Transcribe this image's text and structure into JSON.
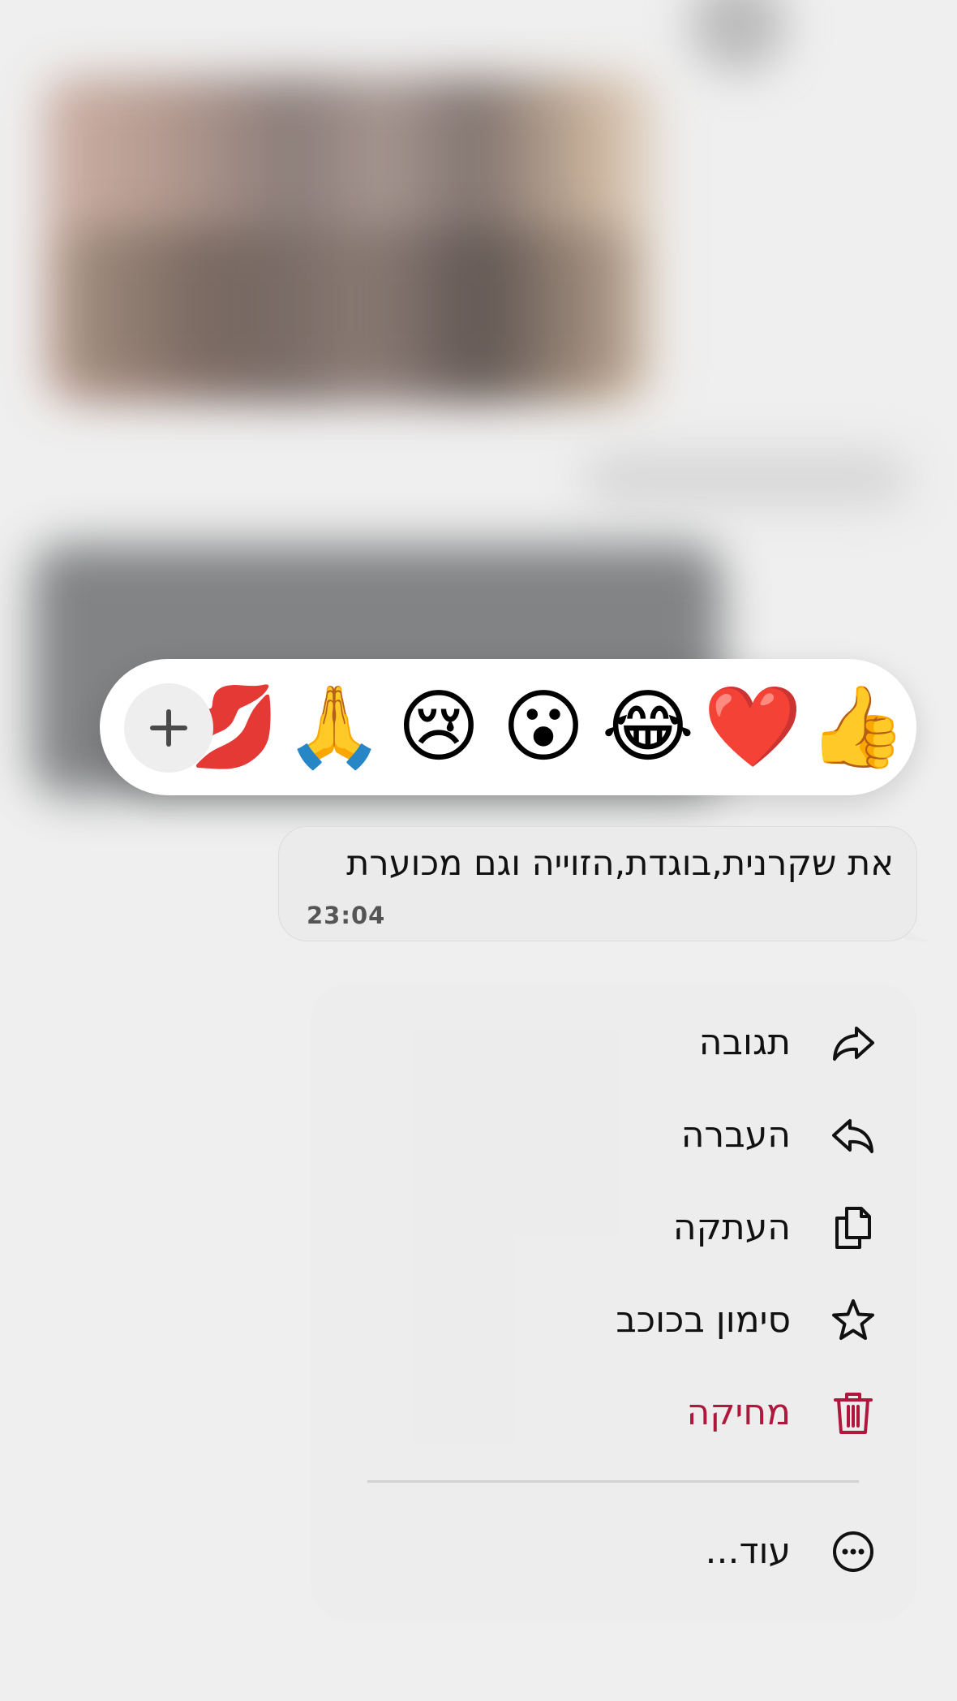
{
  "reactions": {
    "emojis": [
      "👍",
      "❤️",
      "😂",
      "😮",
      "😢",
      "🙏",
      "💋"
    ],
    "add_icon": "plus-icon"
  },
  "message": {
    "text": "את שקרנית,בוגדת,הזוייה וגם מכוערת",
    "time": "23:04"
  },
  "menu": {
    "items": [
      {
        "label": "תגובה",
        "icon": "reply-icon"
      },
      {
        "label": "העברה",
        "icon": "forward-icon"
      },
      {
        "label": "העתקה",
        "icon": "copy-icon"
      },
      {
        "label": "סימון בכוכב",
        "icon": "star-icon"
      },
      {
        "label": "מחיקה",
        "icon": "trash-icon",
        "color": "#b0173c"
      }
    ],
    "more": {
      "label": "עוד...",
      "icon": "more-icon"
    }
  },
  "colors": {
    "danger": "#b0173c",
    "bubble": "#ebebeb",
    "background": "#efefef"
  }
}
